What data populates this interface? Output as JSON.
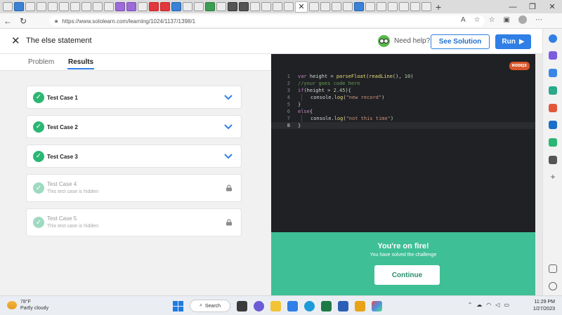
{
  "browser": {
    "url": "https://www.sololearn.com/learning/1024/1137/1398/1"
  },
  "header": {
    "title": "The else statement",
    "need_help": "Need help?",
    "see_solution": "See Solution",
    "run": "Run"
  },
  "tabs": {
    "problem": "Problem",
    "results": "Results"
  },
  "test_cases": [
    {
      "name": "Test Case 1"
    },
    {
      "name": "Test Case 2"
    },
    {
      "name": "Test Case 3"
    },
    {
      "name": "Test Case 4",
      "subtitle": "This test case is hidden"
    },
    {
      "name": "Test Case 5",
      "subtitle": "This test case is hidden"
    }
  ],
  "editor": {
    "language_badge": "NODEJS",
    "line_numbers": [
      "1",
      "2",
      "3",
      "4",
      "5",
      "6",
      "7",
      "8"
    ],
    "code": {
      "l1_kw": "var",
      "l1_a": " height = ",
      "l1_fn1": "parseFloat",
      "l1_b": "(",
      "l1_fn2": "readLine",
      "l1_c": "(), ",
      "l1_num": "10",
      "l1_d": ")",
      "l2_comment": "//your goes code here",
      "l3_kw": "if",
      "l3_a": "(height > ",
      "l3_num": "2.45",
      "l3_b": "){",
      "l4_a": "console.",
      "l4_fn": "log",
      "l4_b": "(",
      "l4_str": "\"new record\"",
      "l4_c": ")",
      "l5": "}",
      "l6_kw": "else",
      "l6_a": "{",
      "l7_a": "console.",
      "l7_fn": "log",
      "l7_b": "(",
      "l7_str": "\"not this time\"",
      "l7_c": ")",
      "l8": "}"
    }
  },
  "success": {
    "title": "You're on fire!",
    "subtitle": "You have solved the challenge",
    "continue": "Continue"
  },
  "taskbar": {
    "temperature": "78°F",
    "condition": "Partly cloudy",
    "search": "Search",
    "time": "11:29 PM",
    "date": "1/27/2023"
  },
  "colors": {
    "accent_blue": "#2f7fe6",
    "success_green": "#3fbf95",
    "check_green": "#2bb673",
    "editor_bg": "#1f2124"
  }
}
